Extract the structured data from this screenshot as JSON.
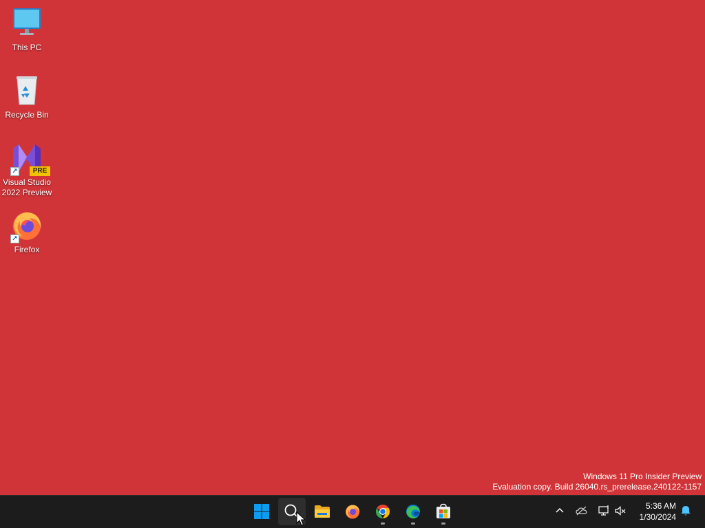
{
  "desktop": {
    "background_color": "#d13438",
    "icons": [
      {
        "label": "This PC",
        "icon": "monitor-icon"
      },
      {
        "label": "Recycle Bin",
        "icon": "recycle-bin-icon"
      },
      {
        "label": "Visual Studio 2022 Preview",
        "icon": "visual-studio-icon",
        "badge": "PRE"
      },
      {
        "label": "Firefox",
        "icon": "firefox-icon"
      }
    ],
    "watermark": {
      "line1": "Windows 11 Pro Insider Preview",
      "line2": "Evaluation copy. Build 26040.rs_prerelease.240122-1157"
    }
  },
  "taskbar": {
    "apps": [
      {
        "name": "Start",
        "icon": "windows-start-icon"
      },
      {
        "name": "Search",
        "icon": "search-icon",
        "active": true
      },
      {
        "name": "File Explorer",
        "icon": "folder-icon"
      },
      {
        "name": "Firefox",
        "icon": "firefox-icon"
      },
      {
        "name": "Google Chrome",
        "icon": "chrome-icon",
        "running": true
      },
      {
        "name": "Microsoft Edge",
        "icon": "edge-icon",
        "running": true
      },
      {
        "name": "Microsoft Store",
        "icon": "store-icon",
        "running": true
      }
    ],
    "tray": {
      "icons": [
        "chevron-up-icon",
        "onedrive-offline-icon",
        "network-icon",
        "volume-muted-icon"
      ],
      "time": "5:36 AM",
      "date": "1/30/2024",
      "notification_icon": "bell-icon"
    }
  }
}
